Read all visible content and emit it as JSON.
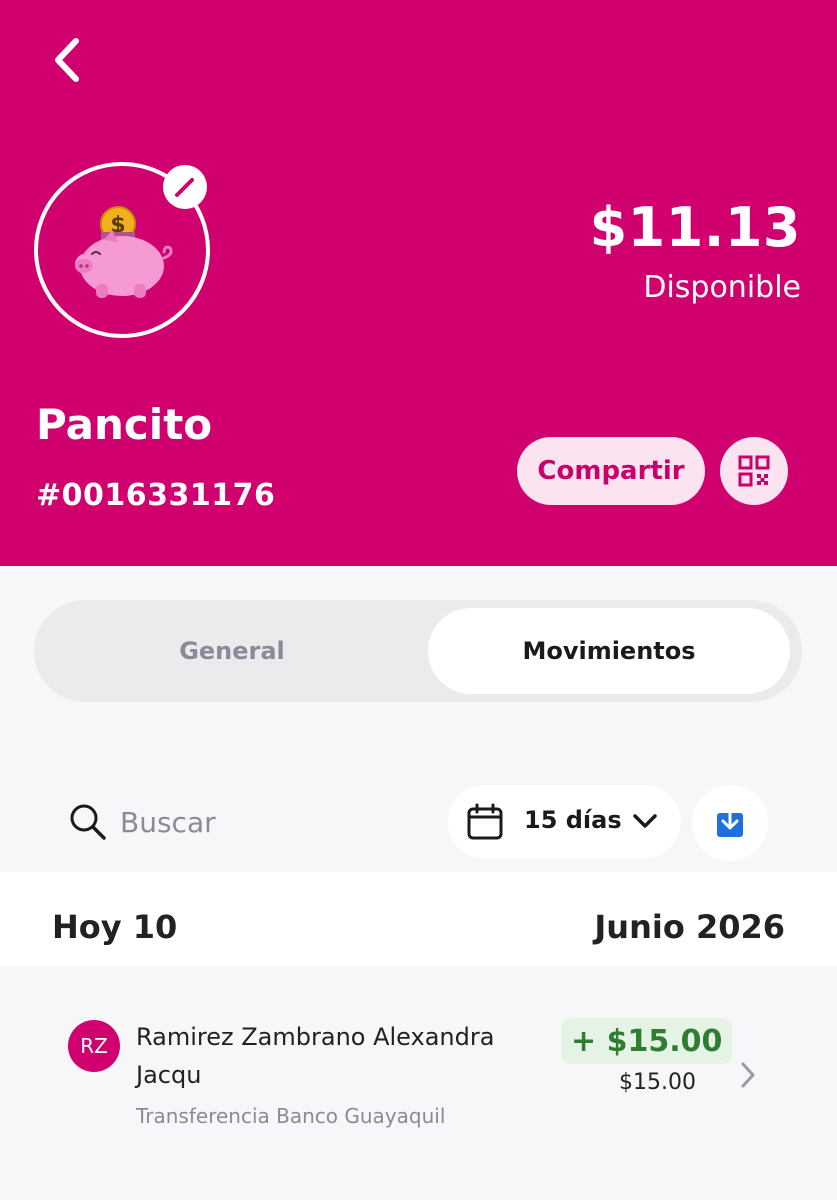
{
  "header": {
    "balance": "$11.13",
    "balance_label": "Disponible",
    "piggy_name": "Pancito",
    "piggy_number": "#0016331176",
    "share_label": "Compartir",
    "bg_color": "#d0006f"
  },
  "tabs": [
    {
      "label": "General",
      "active": false
    },
    {
      "label": "Movimientos",
      "active": true
    }
  ],
  "filters": {
    "search_placeholder": "Buscar",
    "range_label": "15 días"
  },
  "date_header": {
    "day_label": "Hoy 10",
    "month_label": "Junio 2026"
  },
  "transactions": [
    {
      "initials": "RZ",
      "name": "Ramirez Zambrano Alexandra Jacqu",
      "description": "Transferencia Banco Guayaquil",
      "amount_display": "+ $15.00",
      "amount_sub": "$15.00"
    }
  ],
  "icons": {
    "back": "chevron-left-icon",
    "edit": "pencil-icon",
    "qr": "qr-code-icon",
    "search": "search-icon",
    "calendar": "calendar-icon",
    "dropdown": "chevron-down-icon",
    "download": "download-icon",
    "row_chevron": "chevron-right-icon"
  }
}
